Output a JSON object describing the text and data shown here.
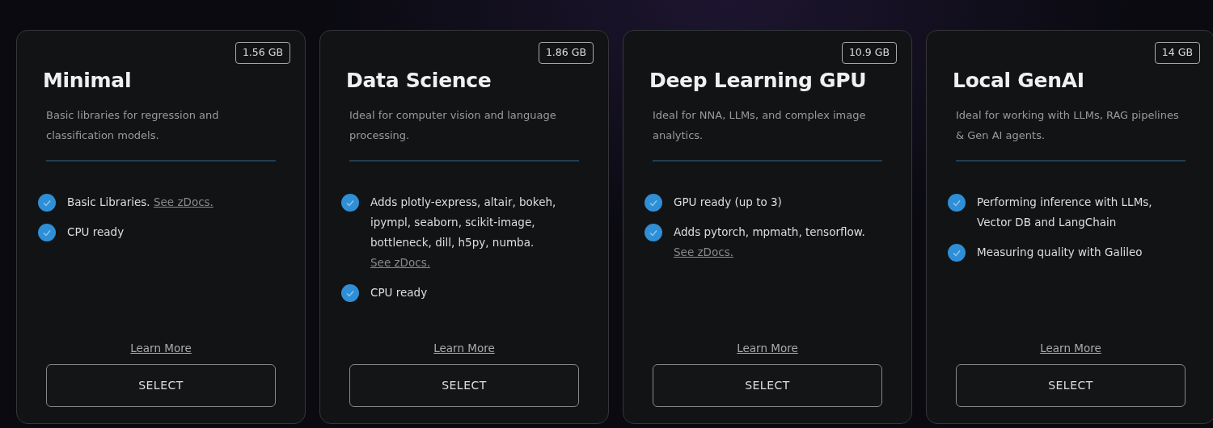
{
  "plans": [
    {
      "size": "1.56 GB",
      "title": "Minimal",
      "description": "Basic libraries for regression and classification models.",
      "features": [
        {
          "text": "Basic Libraries.",
          "link": "See zDocs."
        },
        {
          "text": "CPU ready"
        }
      ],
      "learn_more": "Learn More",
      "button": "SELECT"
    },
    {
      "size": "1.86 GB",
      "title": "Data Science",
      "description": "Ideal for computer vision and language processing.",
      "features": [
        {
          "text": "Adds plotly-express, altair, bokeh, ipympl, seaborn, scikit-image, bottleneck, dill, h5py, numba.",
          "link": "See zDocs."
        },
        {
          "text": "CPU ready"
        }
      ],
      "learn_more": "Learn More",
      "button": "SELECT"
    },
    {
      "size": "10.9 GB",
      "title": "Deep Learning GPU",
      "description": "Ideal for NNA, LLMs, and complex image analytics.",
      "features": [
        {
          "text": "GPU ready (up to 3)"
        },
        {
          "text": "Adds pytorch, mpmath, tensorflow.",
          "link": "See zDocs."
        }
      ],
      "learn_more": "Learn More",
      "button": "SELECT"
    },
    {
      "size": "14 GB",
      "title": "Local GenAI",
      "description": "Ideal for working with LLMs, RAG pipelines & Gen AI agents.",
      "features": [
        {
          "text": "Performing inference with LLMs, Vector DB and LangChain"
        },
        {
          "text": "Measuring quality with Galileo"
        }
      ],
      "learn_more": "Learn More",
      "button": "SELECT"
    }
  ]
}
